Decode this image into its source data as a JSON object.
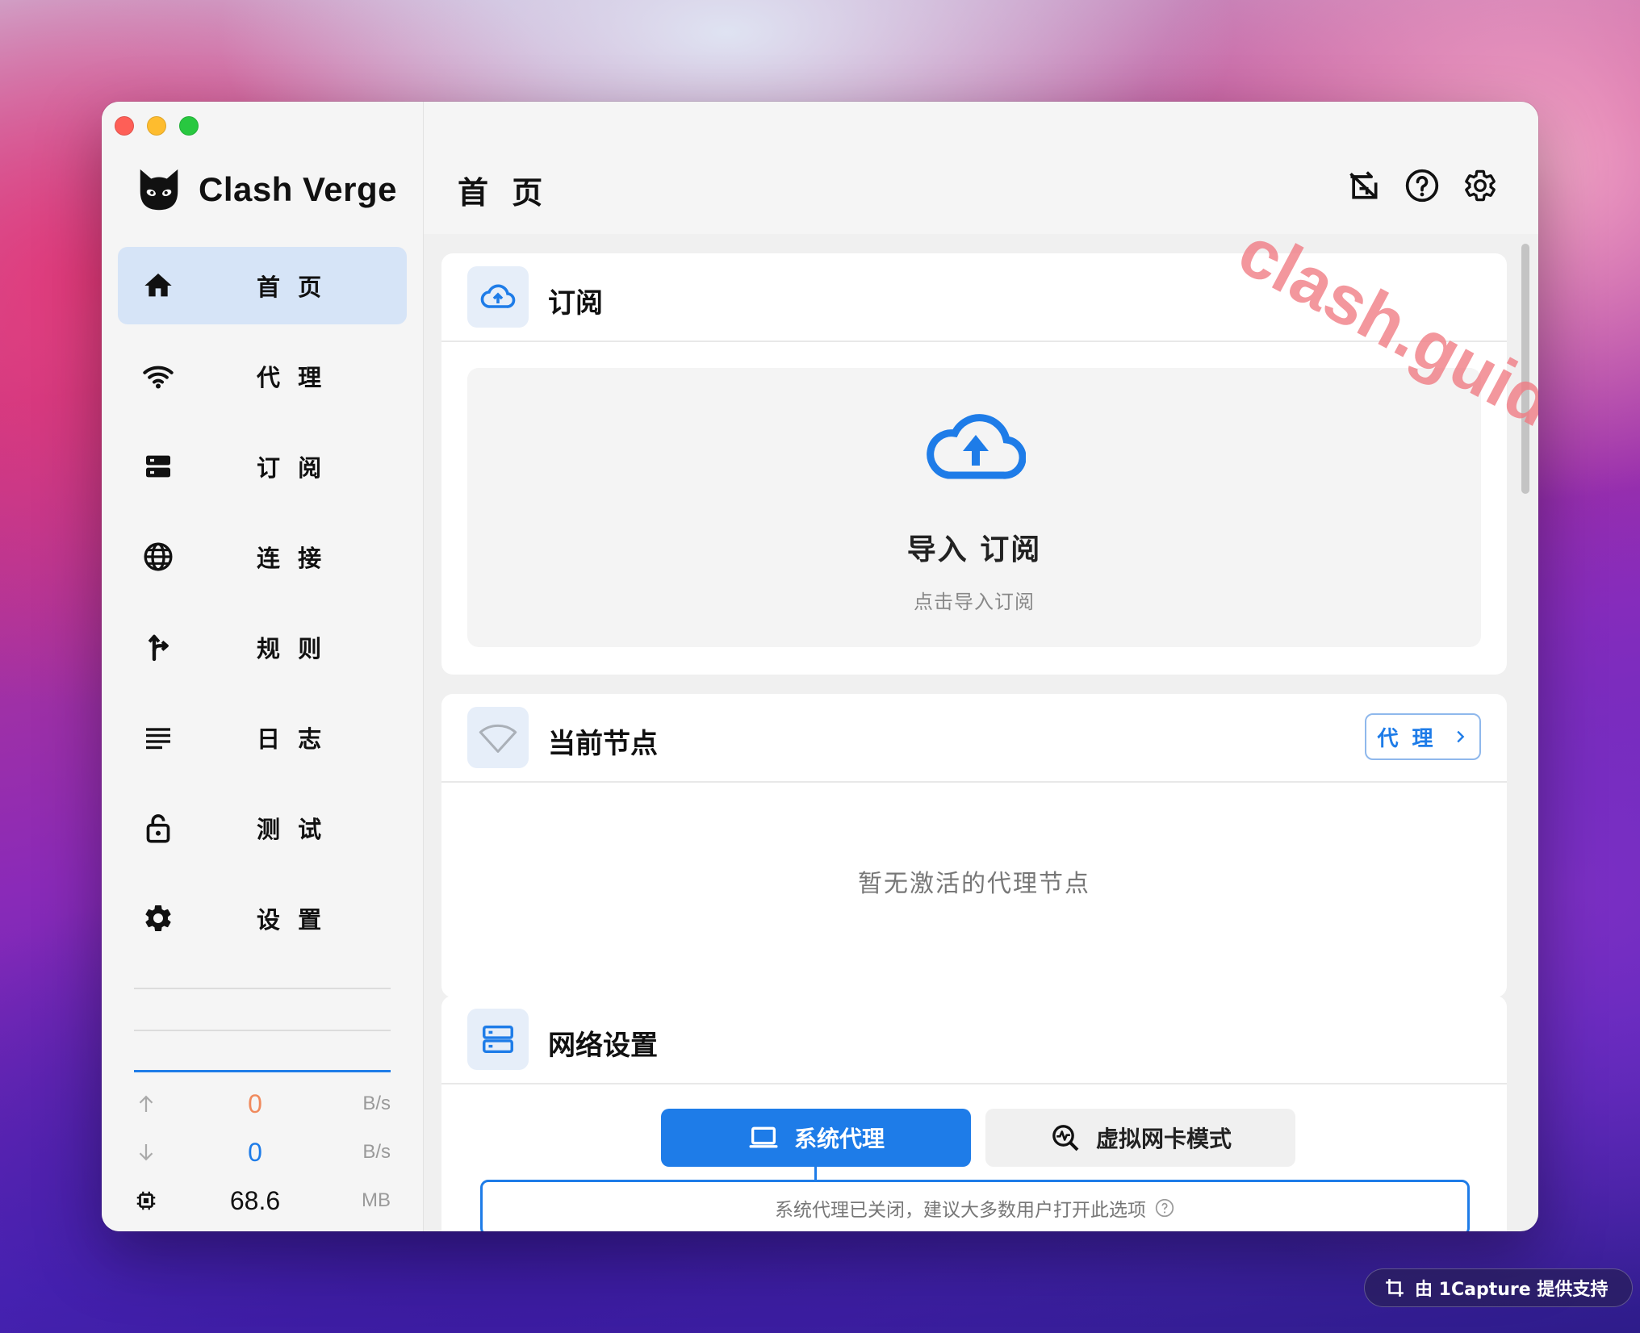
{
  "app": {
    "name": "Clash Verge"
  },
  "sidebar": {
    "items": [
      {
        "label": "首 页",
        "icon": "home-icon",
        "active": true
      },
      {
        "label": "代 理",
        "icon": "wifi-icon",
        "active": false
      },
      {
        "label": "订 阅",
        "icon": "storage-icon",
        "active": false
      },
      {
        "label": "连 接",
        "icon": "globe-icon",
        "active": false
      },
      {
        "label": "规 则",
        "icon": "fork-arrow-icon",
        "active": false
      },
      {
        "label": "日 志",
        "icon": "list-lines-icon",
        "active": false
      },
      {
        "label": "测 试",
        "icon": "lock-open-icon",
        "active": false
      },
      {
        "label": "设 置",
        "icon": "gear-icon",
        "active": false
      }
    ],
    "traffic": {
      "upload": {
        "value": "0",
        "unit": "B/s",
        "color": "#f08a5d"
      },
      "download": {
        "value": "0",
        "unit": "B/s",
        "color": "#1e7ce8"
      },
      "memory": {
        "value": "68.6",
        "unit": "MB"
      }
    }
  },
  "header": {
    "title": "首 页",
    "actions": [
      "swap-icon",
      "help-icon",
      "settings-icon"
    ]
  },
  "watermark": "clash.guide",
  "cards": {
    "subscription": {
      "title": "订阅",
      "import_title": "导入 订阅",
      "import_sub": "点击导入订阅"
    },
    "current_node": {
      "title": "当前节点",
      "proxy_button": "代 理",
      "empty": "暂无激活的代理节点"
    },
    "network": {
      "title": "网络设置",
      "tabs": [
        {
          "label": "系统代理",
          "active": true
        },
        {
          "label": "虚拟网卡模式",
          "active": false
        }
      ],
      "description": "系统代理已关闭，建议大多数用户打开此选项"
    }
  },
  "capture_badge": "由 1Capture 提供支持",
  "colors": {
    "accent": "#1e7ce8",
    "active_nav": "#d6e4f7",
    "watermark": "#f07a82"
  }
}
